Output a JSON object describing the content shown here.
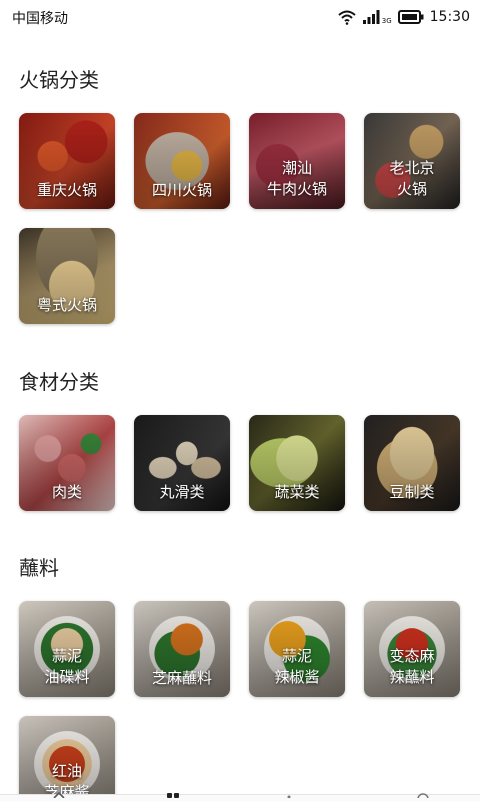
{
  "status_bar": {
    "carrier": "中国移动",
    "network": "3G",
    "time": "15:30",
    "icons": [
      "wifi-icon",
      "signal-icon",
      "battery-icon"
    ]
  },
  "sections": [
    {
      "title": "火锅分类",
      "items": [
        {
          "label": "重庆火锅"
        },
        {
          "label": "四川火锅"
        },
        {
          "label": "潮汕\n牛肉火锅"
        },
        {
          "label": "老北京\n火锅"
        },
        {
          "label": "粤式火锅"
        }
      ]
    },
    {
      "title": "食材分类",
      "items": [
        {
          "label": "肉类"
        },
        {
          "label": "丸滑类"
        },
        {
          "label": "蔬菜类"
        },
        {
          "label": "豆制类"
        }
      ]
    },
    {
      "title": "蘸料",
      "items": [
        {
          "label": "蒜泥\n油碟料"
        },
        {
          "label": "芝麻蘸料"
        },
        {
          "label": "蒜泥\n辣椒酱"
        },
        {
          "label": "变态麻\n辣蘸料"
        },
        {
          "label": "红油\n芝麻酱"
        }
      ]
    }
  ],
  "tab_bar": {
    "icons": [
      "home-tab-icon",
      "category-tab-icon",
      "discover-tab-icon",
      "profile-tab-icon"
    ]
  }
}
